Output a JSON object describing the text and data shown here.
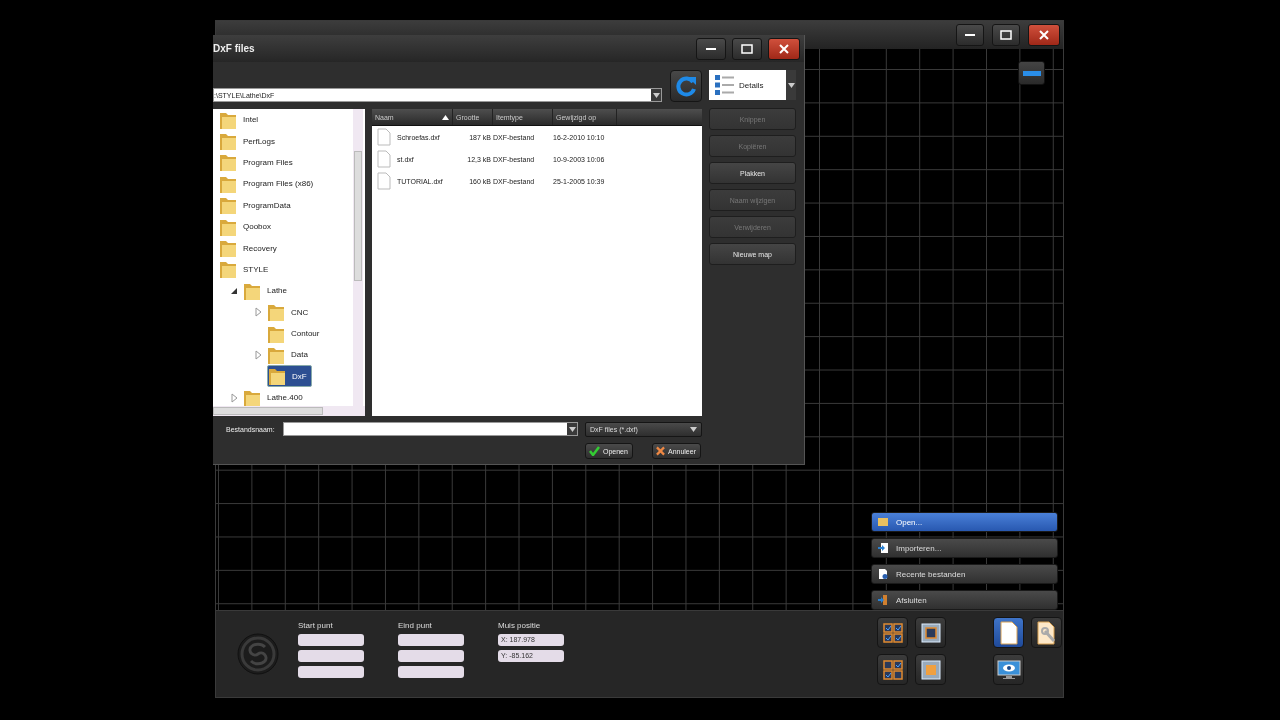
{
  "dialog": {
    "title": "DxF files",
    "path": ":\\STYLE\\Lathe\\DxF",
    "view": "Details",
    "tree": [
      {
        "label": "Intel",
        "selected": false
      },
      {
        "label": "PerfLogs",
        "selected": false
      },
      {
        "label": "Program Files",
        "selected": false
      },
      {
        "label": "Program Files (x86)",
        "selected": false
      },
      {
        "label": "ProgramData",
        "selected": false
      },
      {
        "label": "Qoobox",
        "selected": false
      },
      {
        "label": "Recovery",
        "selected": false
      },
      {
        "label": "STYLE",
        "selected": false,
        "children": [
          {
            "label": "Lathe",
            "expanded": true,
            "selected": false,
            "children": [
              {
                "label": "CNC",
                "expanded": false,
                "selected": false
              },
              {
                "label": "Contour",
                "selected": false
              },
              {
                "label": "Data",
                "expanded": false,
                "selected": false
              },
              {
                "label": "DxF",
                "selected": true
              }
            ]
          },
          {
            "label": "Lathe.400",
            "expanded": false,
            "selected": false
          }
        ]
      }
    ],
    "columns": [
      {
        "label": "Naam",
        "sorted": true
      },
      {
        "label": "Grootte",
        "sorted": false
      },
      {
        "label": "Itemtype",
        "sorted": false
      },
      {
        "label": "Gewijzigd op",
        "sorted": false
      }
    ],
    "files": [
      {
        "name": "Schroefas.dxf",
        "size": "187 kB",
        "type": "DXF-bestand",
        "modified": "16-2-2010 10:10"
      },
      {
        "name": "st.dxf",
        "size": "12,3 kB",
        "type": "DXF-bestand",
        "modified": "10-9-2003 10:06"
      },
      {
        "name": "TUTORIAL.dxf",
        "size": "160 kB",
        "type": "DXF-bestand",
        "modified": "25-1-2005 10:39"
      }
    ],
    "actions": [
      {
        "label": "Knippen",
        "disabled": true
      },
      {
        "label": "Kopiëren",
        "disabled": true
      },
      {
        "label": "Plakken",
        "disabled": false
      },
      {
        "label": "Naam wijzigen",
        "disabled": true
      },
      {
        "label": "Verwijderen",
        "disabled": true
      },
      {
        "label": "Nieuwe map",
        "disabled": false
      }
    ],
    "filename_label": "Bestandsnaam:",
    "filter": "DxF files (*.dxf)",
    "buttons": [
      {
        "label": "Openen",
        "kind": "ok"
      },
      {
        "label": "Annuleer",
        "kind": "cancel"
      }
    ]
  },
  "menu": [
    {
      "label": "Open...",
      "selected": true
    },
    {
      "label": "Importeren...",
      "selected": false
    },
    {
      "label": "Recente bestanden",
      "selected": false
    },
    {
      "label": "Afsluiten",
      "selected": false
    }
  ],
  "coordinates": {
    "start_label": "Start punt",
    "end_label": "Eind punt",
    "mouse_label": "Muis positie",
    "mouse_values": [
      "X: 187.978",
      "Y: -85.162"
    ]
  },
  "tool_buttons": [
    {
      "selected": false
    },
    {
      "selected": false
    },
    {
      "selected": true
    },
    {
      "selected": false
    },
    {
      "selected": false
    },
    {
      "selected": false
    },
    {
      "selected": false
    }
  ]
}
